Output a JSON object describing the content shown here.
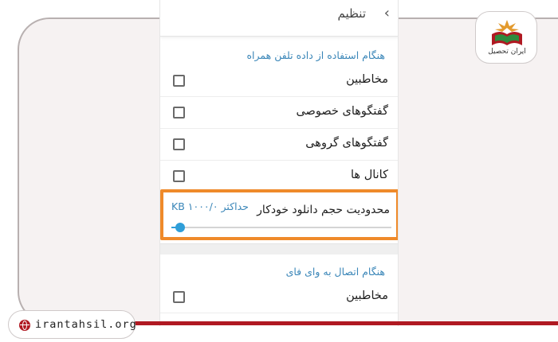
{
  "header": {
    "partial_title": "تنظیم",
    "back_icon": "chevron-icon"
  },
  "mobile_section": {
    "title": "هنگام استفاده از داده تلفن همراه",
    "items": [
      {
        "label": "مخاطبین",
        "checked": false
      },
      {
        "label": "گفتگوهای خصوصی",
        "checked": false
      },
      {
        "label": "گفتگوهای گروهی",
        "checked": false
      },
      {
        "label": "کانال ها",
        "checked": false
      }
    ]
  },
  "auto_download": {
    "label": "محدودیت حجم دانلود خودکار",
    "value_text": "حداکثر ۱۰۰۰/۰ KB",
    "slider_fraction": 0.04,
    "highlight_color": "#ef8a2a",
    "accent_color": "#2f9ed8"
  },
  "wifi_section": {
    "title": "هنگام اتصال به وای فای",
    "items": [
      {
        "label": "مخاطبین",
        "checked": false
      }
    ]
  },
  "brand": {
    "logo_text": "ایران تحصیل",
    "website": "irantahsil.org",
    "brand_color": "#b01922"
  }
}
